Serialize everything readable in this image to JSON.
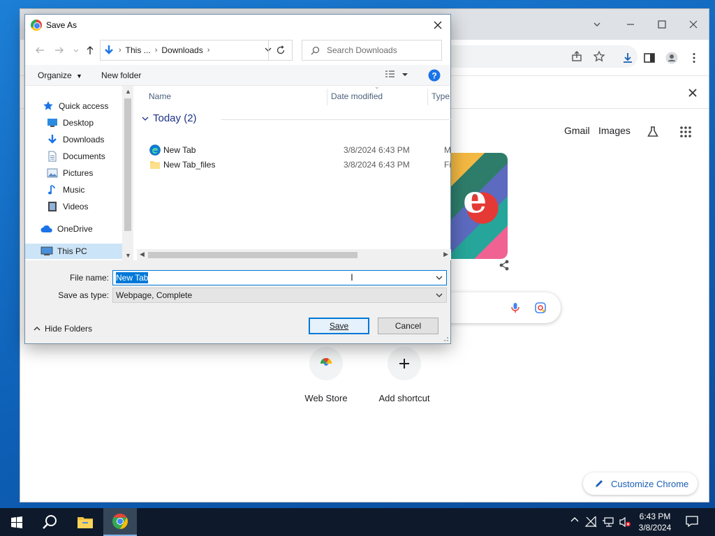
{
  "browser": {
    "header_links": {
      "gmail": "Gmail",
      "images": "Images"
    },
    "shortcuts": [
      {
        "label": "Web Store"
      },
      {
        "label": "Add shortcut"
      }
    ],
    "customize_label": "Customize Chrome"
  },
  "dialog": {
    "title": "Save As",
    "breadcrumb": {
      "root": "This ...",
      "current": "Downloads"
    },
    "search_placeholder": "Search Downloads",
    "toolbar": {
      "organize": "Organize",
      "new_folder": "New folder"
    },
    "nav_items": [
      {
        "label": "Quick access",
        "icon": "star-icon",
        "pinned": false
      },
      {
        "label": "Desktop",
        "icon": "desktop-icon",
        "pinned": true
      },
      {
        "label": "Downloads",
        "icon": "download-icon",
        "pinned": true
      },
      {
        "label": "Documents",
        "icon": "document-icon",
        "pinned": true
      },
      {
        "label": "Pictures",
        "icon": "pictures-icon",
        "pinned": true
      },
      {
        "label": "Music",
        "icon": "music-icon",
        "pinned": false
      },
      {
        "label": "Videos",
        "icon": "video-icon",
        "pinned": false
      },
      {
        "label": "OneDrive",
        "icon": "cloud-icon",
        "pinned": false
      },
      {
        "label": "This PC",
        "icon": "computer-icon",
        "pinned": false,
        "selected": true
      }
    ],
    "columns": {
      "name": "Name",
      "date": "Date modified",
      "type": "Type"
    },
    "group": {
      "label": "Today (2)"
    },
    "files": [
      {
        "name": "New Tab",
        "date": "3/8/2024 6:43 PM",
        "type": "Micro",
        "icon": "edge-icon"
      },
      {
        "name": "New Tab_files",
        "date": "3/8/2024 6:43 PM",
        "type": "File fo",
        "icon": "folder-icon"
      }
    ],
    "file_name_label": "File name:",
    "file_name_value": "New Tab",
    "save_type_label": "Save as type:",
    "save_type_value": "Webpage, Complete",
    "hide_folders": "Hide Folders",
    "save_button": "Save",
    "cancel_button": "Cancel"
  },
  "taskbar": {
    "time": "6:43 PM",
    "date": "3/8/2024"
  }
}
